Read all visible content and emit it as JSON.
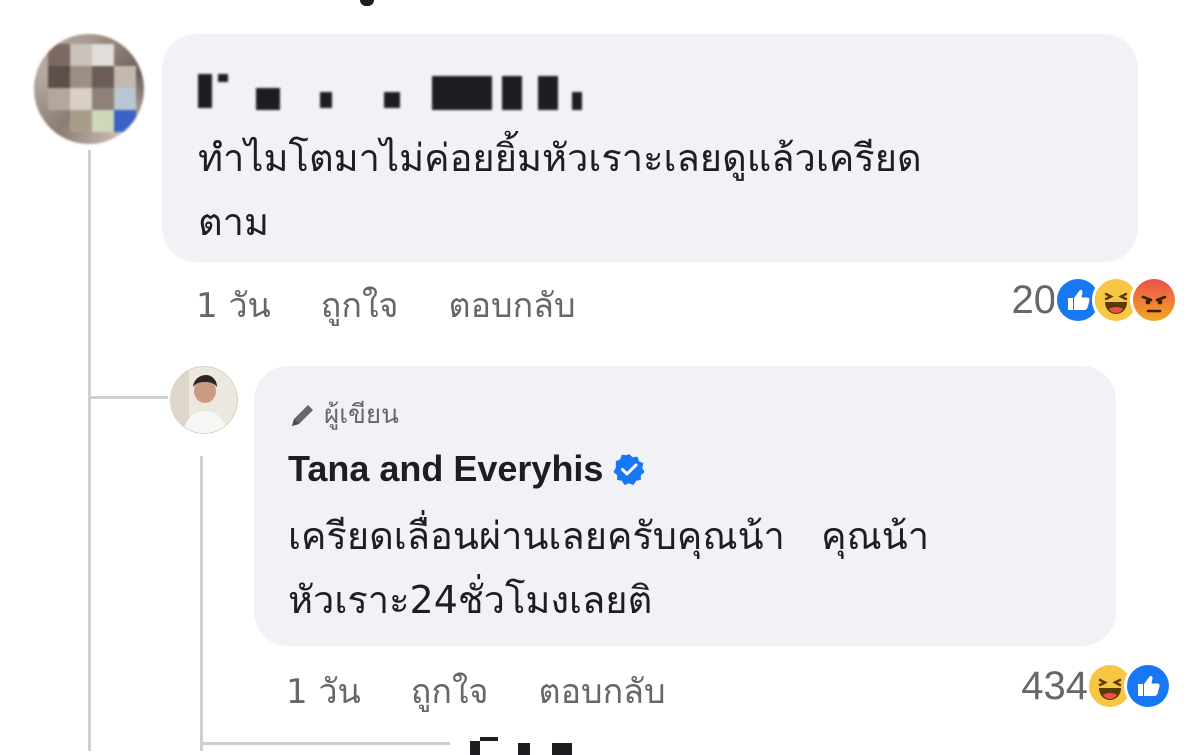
{
  "comment1": {
    "text": "ทำไมโตมาไม่ค่อยยิ้มหัวเราะเลยดูแล้วเครียด\nตาม",
    "time": "1 วัน",
    "like_label": "ถูกใจ",
    "reply_label": "ตอบกลับ",
    "reaction_count": "20",
    "reactions": [
      "like-icon",
      "haha-icon",
      "angry-icon"
    ]
  },
  "reply": {
    "badge": "ผู้เขียน",
    "author": "Tana and Everyhis",
    "text": "เครียดเลื่อนผ่านเลยครับคุณน้า   คุณน้า\nหัวเราะ24ชั่วโมงเลยติ",
    "time": "1 วัน",
    "like_label": "ถูกใจ",
    "reply_label": "ตอบกลับ",
    "reaction_count": "434",
    "reactions": [
      "haha-icon",
      "like-icon"
    ]
  },
  "colors": {
    "bubble": "#f0f2f5",
    "secondary_text": "#65676b",
    "like_blue": "#1877f2",
    "haha_yellow": "#f7c744",
    "angry_orange": "#e9710f",
    "verified_blue": "#1877f2"
  }
}
